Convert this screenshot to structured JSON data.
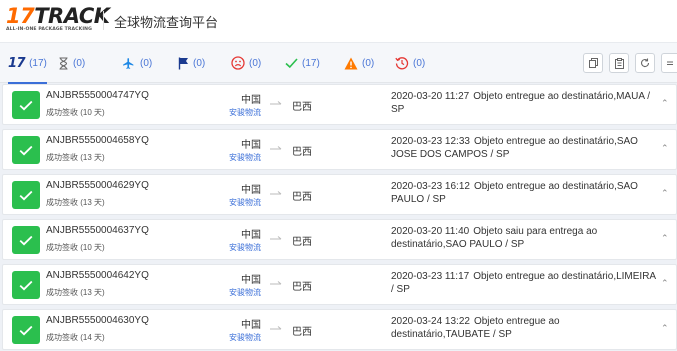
{
  "header": {
    "logo_num": "17",
    "logo_text": "TRACK",
    "logo_tagline": "ALL-IN-ONE PACKAGE TRACKING",
    "title": "全球物流查询平台"
  },
  "tabs": [
    {
      "id": "all",
      "count": "(17)",
      "icon": "17track-icon",
      "color": "#1a3a8f"
    },
    {
      "id": "not-found",
      "count": "(0)",
      "icon": "hourglass-icon",
      "color": "#666666"
    },
    {
      "id": "in-transit",
      "count": "(0)",
      "icon": "airplane-icon",
      "color": "#1e88e5"
    },
    {
      "id": "pickup",
      "count": "(0)",
      "icon": "flag-icon",
      "color": "#1a3a8f"
    },
    {
      "id": "undelivered",
      "count": "(0)",
      "icon": "sad-face-icon",
      "color": "#e53935"
    },
    {
      "id": "delivered",
      "count": "(17)",
      "icon": "checkmark-icon",
      "color": "#2bbf4e"
    },
    {
      "id": "alert",
      "count": "(0)",
      "icon": "warning-icon",
      "color": "#ff7a00"
    },
    {
      "id": "expired",
      "count": "(0)",
      "icon": "clock-back-icon",
      "color": "#e53935"
    }
  ],
  "toolbar": [
    "copy-icon",
    "paste-icon",
    "refresh-icon",
    "expand-icon"
  ],
  "colors": {
    "accent": "#3b6fd8",
    "success": "#2bbf4e",
    "brand_orange": "#ff6a00"
  },
  "shipments": [
    {
      "tracking": "ANJBR5550004747YQ",
      "status": "成功签收 (10 天)",
      "origin": "中国",
      "carrier": "安骏物流",
      "dest": "巴西",
      "time": "2020-03-20 11:27",
      "event": "Objeto entregue ao destinatário,MAUA / SP"
    },
    {
      "tracking": "ANJBR5550004658YQ",
      "status": "成功签收 (13 天)",
      "origin": "中国",
      "carrier": "安骏物流",
      "dest": "巴西",
      "time": "2020-03-23 12:33",
      "event": "Objeto entregue ao destinatário,SAO JOSE DOS CAMPOS / SP"
    },
    {
      "tracking": "ANJBR5550004629YQ",
      "status": "成功签收 (13 天)",
      "origin": "中国",
      "carrier": "安骏物流",
      "dest": "巴西",
      "time": "2020-03-23 16:12",
      "event": "Objeto entregue ao destinatário,SAO PAULO / SP"
    },
    {
      "tracking": "ANJBR5550004637YQ",
      "status": "成功签收 (10 天)",
      "origin": "中国",
      "carrier": "安骏物流",
      "dest": "巴西",
      "time": "2020-03-20 11:40",
      "event": "Objeto saiu para entrega ao destinatário,SAO PAULO / SP"
    },
    {
      "tracking": "ANJBR5550004642YQ",
      "status": "成功签收 (13 天)",
      "origin": "中国",
      "carrier": "安骏物流",
      "dest": "巴西",
      "time": "2020-03-23 11:17",
      "event": "Objeto entregue ao destinatário,LIMEIRA / SP"
    },
    {
      "tracking": "ANJBR5550004630YQ",
      "status": "成功签收 (14 天)",
      "origin": "中国",
      "carrier": "安骏物流",
      "dest": "巴西",
      "time": "2020-03-24 13:22",
      "event": "Objeto entregue ao destinatário,TAUBATE / SP"
    }
  ]
}
